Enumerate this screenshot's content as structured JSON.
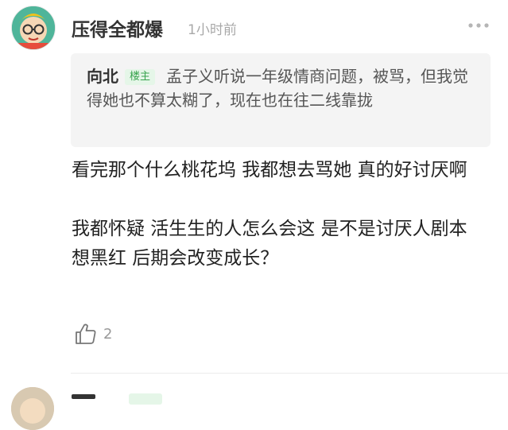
{
  "comment": {
    "username": "压得全都爆",
    "time": "1小时前",
    "more_icon": "more-dots-icon",
    "quote": {
      "author": "向北",
      "badge": "楼主",
      "text": "孟子义听说一年级情商问题，被骂，但我觉得她也不算太糊了，现在也在往二线靠拢"
    },
    "body": "看完那个什么桃花坞 我都想去骂她 真的好讨厌啊\n\n我都怀疑 活生生的人怎么会这 是不是讨厌人剧本 想黑红 后期会改变成长？",
    "like_icon": "thumbs-up-icon",
    "like_count": "2"
  },
  "colors": {
    "badge_bg": "#e5f6e8",
    "badge_text": "#38a34e",
    "quote_bg": "#f4f4f4",
    "muted": "#a9a9a9"
  }
}
